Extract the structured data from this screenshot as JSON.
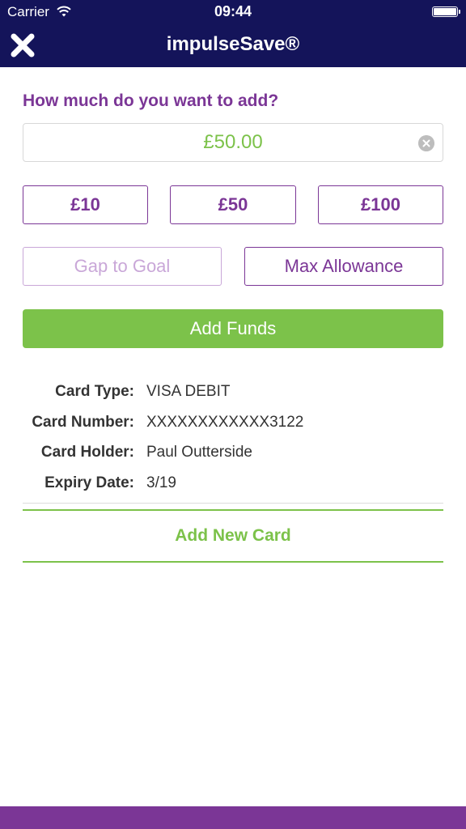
{
  "status_bar": {
    "carrier": "Carrier",
    "time": "09:44",
    "icons": [
      "wifi-icon",
      "battery-icon"
    ]
  },
  "nav": {
    "title": "impulseSave®",
    "close_icon": "close-icon"
  },
  "form": {
    "question": "How much do you want to add?",
    "amount_value": "£50.00",
    "clear_icon": "clear-icon"
  },
  "quick_amounts": [
    "£10",
    "£50",
    "£100"
  ],
  "options": {
    "gap_to_goal": "Gap to Goal",
    "max_allowance": "Max Allowance"
  },
  "add_funds_label": "Add Funds",
  "card": {
    "rows": [
      {
        "label": "Card Type:",
        "value": "VISA DEBIT"
      },
      {
        "label": "Card Number:",
        "value": "XXXXXXXXXXXX3122"
      },
      {
        "label": "Card Holder:",
        "value": "Paul Outterside"
      },
      {
        "label": "Expiry Date:",
        "value": "3/19"
      }
    ]
  },
  "add_new_card_label": "Add New Card",
  "colors": {
    "nav_background": "#14145a",
    "accent_purple": "#7b3696",
    "muted_purple": "#c9a7d8",
    "accent_green": "#7cc24a",
    "bottom_bar": "#7b3696"
  }
}
